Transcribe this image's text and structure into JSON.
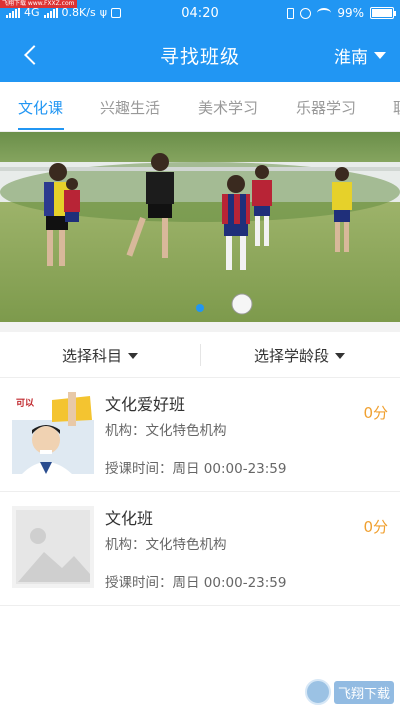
{
  "status_bar": {
    "network": "0.8K/s",
    "network_type": "4G",
    "time": "04:20",
    "battery": "99%",
    "battery_level": 0.99
  },
  "corner_watermark": "飞翔下载 www.FXXZ.com",
  "header": {
    "title": "寻找班级",
    "city": "淮南",
    "back_icon": "chevron-left-icon"
  },
  "tabs": [
    {
      "label": "文化课",
      "active": true
    },
    {
      "label": "兴趣生活",
      "active": false
    },
    {
      "label": "美术学习",
      "active": false
    },
    {
      "label": "乐器学习",
      "active": false
    },
    {
      "label": "职",
      "active": false
    }
  ],
  "banner": {
    "pagination_count": 1,
    "current": 1
  },
  "filters": {
    "subject": "选择科目",
    "age": "选择学龄段"
  },
  "classes": [
    {
      "name": "文化爱好班",
      "org": "机构：文化特色机构",
      "time": "授课时间：周日 00:00-23:59",
      "score": "0分",
      "thumb_text": "可以"
    },
    {
      "name": "文化班",
      "org": "机构：文化特色机构",
      "time": "授课时间：周日 00:00-23:59",
      "score": "0分"
    }
  ],
  "watermark": "飞翔下载",
  "colors": {
    "primary": "#2196f3",
    "score": "#f0a030"
  }
}
